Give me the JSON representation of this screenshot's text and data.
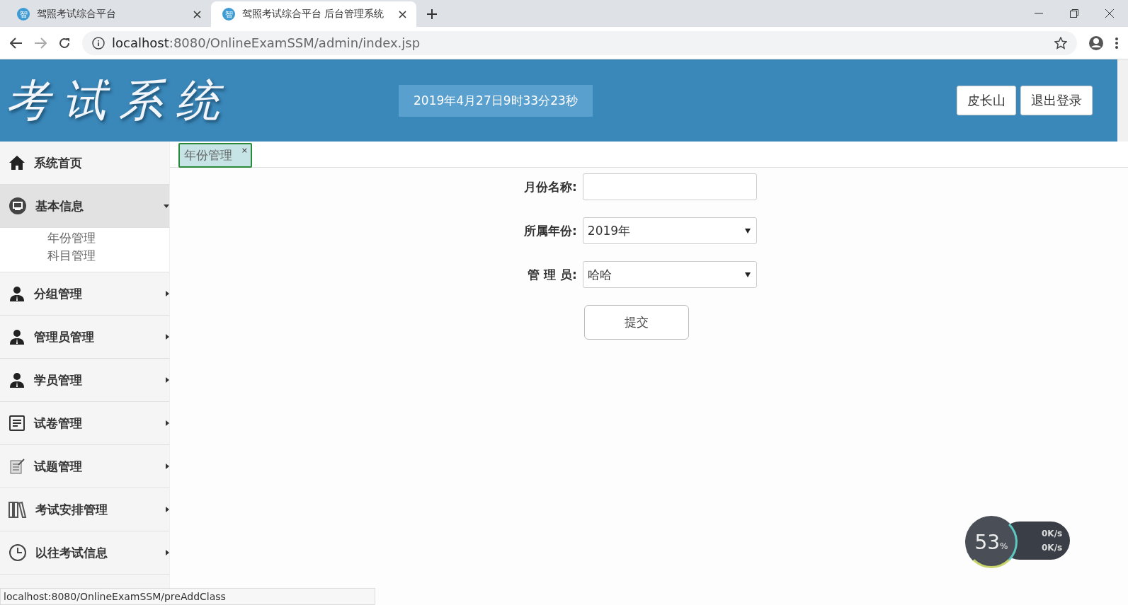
{
  "browser": {
    "tabs": [
      {
        "title": "驾照考试综合平台",
        "favicon": "智",
        "selected": false
      },
      {
        "title": "驾照考试综合平台 后台管理系统",
        "favicon": "智",
        "selected": true
      }
    ],
    "url_host": "localhost",
    "url_rest": ":8080/OnlineExamSSM/admin/index.jsp"
  },
  "header": {
    "logo": "考试系统",
    "clock": "2019年4月27日9时33分23秒",
    "buttons": [
      "皮长山",
      "退出登录"
    ]
  },
  "sidebar": {
    "items": [
      {
        "label": "系统首页",
        "expanded": false
      },
      {
        "label": "基本信息",
        "expanded": true,
        "children": [
          "年份管理",
          "科目管理"
        ]
      },
      {
        "label": "分组管理",
        "expanded": false
      },
      {
        "label": "管理员管理",
        "expanded": false
      },
      {
        "label": "学员管理",
        "expanded": false
      },
      {
        "label": "试卷管理",
        "expanded": false
      },
      {
        "label": "试题管理",
        "expanded": false
      },
      {
        "label": "考试安排管理",
        "expanded": false
      },
      {
        "label": "以往考试信息",
        "expanded": false
      }
    ]
  },
  "content_tabs": [
    {
      "label": "年份管理",
      "close": "×",
      "selected": true
    }
  ],
  "form": {
    "fields": [
      {
        "kind": "input",
        "label": "月份名称:"
      },
      {
        "kind": "select",
        "label": "所属年份:",
        "value": "2019年"
      },
      {
        "kind": "select",
        "label": "管 理 员:",
        "value": "哈哈"
      }
    ],
    "submit": "提交"
  },
  "status_bar": "localhost:8080/OnlineExamSSM/preAddClass",
  "speed_widget": {
    "percent": "53",
    "unit": "%",
    "upload": "0K/s",
    "download": "0K/s"
  }
}
